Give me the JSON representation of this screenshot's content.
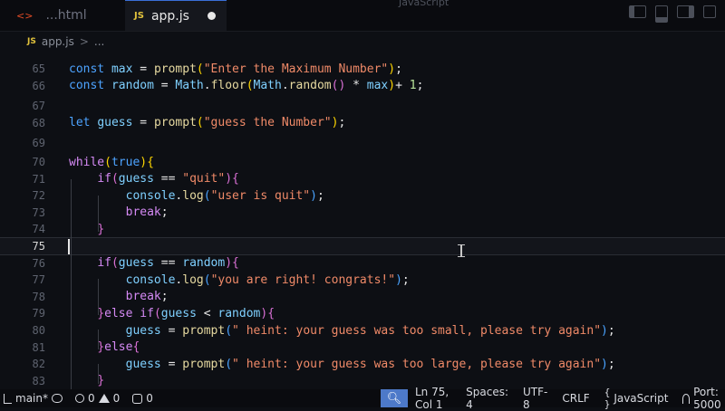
{
  "window_title": "JavaScript",
  "tabs": [
    {
      "label": "...html",
      "lead": "<>",
      "active": false
    },
    {
      "label": "app.js",
      "badge": "JS",
      "active": true,
      "modified": true
    }
  ],
  "breadcrumb": {
    "badge": "JS",
    "file": "app.js",
    "separator": ">",
    "more": "..."
  },
  "editor": {
    "current_line": 75,
    "lines": [
      {
        "num": "65",
        "tokens": [
          [
            "kw",
            "const "
          ],
          [
            "var",
            "max"
          ],
          [
            "op",
            " = "
          ],
          [
            "fn",
            "prompt"
          ],
          [
            "br1",
            "("
          ],
          [
            "str",
            "\"Enter the Maximum Number\""
          ],
          [
            "br1",
            ")"
          ],
          [
            "op",
            ";"
          ]
        ]
      },
      {
        "num": "66",
        "tokens": [
          [
            "kw",
            "const "
          ],
          [
            "var",
            "random"
          ],
          [
            "op",
            " = "
          ],
          [
            "obj",
            "Math"
          ],
          [
            "op",
            "."
          ],
          [
            "fn",
            "floor"
          ],
          [
            "br1",
            "("
          ],
          [
            "obj",
            "Math"
          ],
          [
            "op",
            "."
          ],
          [
            "fn",
            "random"
          ],
          [
            "br2",
            "()"
          ],
          [
            "op",
            " * "
          ],
          [
            "var",
            "max"
          ],
          [
            "br1",
            ")"
          ],
          [
            "op",
            "+ "
          ],
          [
            "num",
            "1"
          ],
          [
            "op",
            ";"
          ]
        ]
      },
      {
        "num": "67",
        "tokens": []
      },
      {
        "num": "68",
        "tokens": [
          [
            "kw",
            "let "
          ],
          [
            "var",
            "guess"
          ],
          [
            "op",
            " = "
          ],
          [
            "fn",
            "prompt"
          ],
          [
            "br1",
            "("
          ],
          [
            "str",
            "\"guess the Number\""
          ],
          [
            "br1",
            ")"
          ],
          [
            "op",
            ";"
          ]
        ]
      },
      {
        "num": "69",
        "tokens": []
      },
      {
        "num": "70",
        "tokens": [
          [
            "ctl",
            "while"
          ],
          [
            "br1",
            "("
          ],
          [
            "bool",
            "true"
          ],
          [
            "br1",
            ")"
          ],
          [
            "br1",
            "{"
          ]
        ]
      },
      {
        "num": "71",
        "tokens": [
          [
            "op",
            "    "
          ],
          [
            "ctl",
            "if"
          ],
          [
            "br2",
            "("
          ],
          [
            "var",
            "guess"
          ],
          [
            "op",
            " == "
          ],
          [
            "str",
            "\"quit\""
          ],
          [
            "br2",
            ")"
          ],
          [
            "br2",
            "{"
          ]
        ]
      },
      {
        "num": "72",
        "tokens": [
          [
            "op",
            "        "
          ],
          [
            "var",
            "console"
          ],
          [
            "op",
            "."
          ],
          [
            "fn",
            "log"
          ],
          [
            "br3",
            "("
          ],
          [
            "str",
            "\"user is quit\""
          ],
          [
            "br3",
            ")"
          ],
          [
            "op",
            ";"
          ]
        ]
      },
      {
        "num": "73",
        "tokens": [
          [
            "op",
            "        "
          ],
          [
            "ctl",
            "break"
          ],
          [
            "op",
            ";"
          ]
        ]
      },
      {
        "num": "74",
        "tokens": [
          [
            "op",
            "    "
          ],
          [
            "br2",
            "}"
          ]
        ]
      },
      {
        "num": "75",
        "tokens": []
      },
      {
        "num": "76",
        "tokens": [
          [
            "op",
            "    "
          ],
          [
            "ctl",
            "if"
          ],
          [
            "br2",
            "("
          ],
          [
            "var",
            "guess"
          ],
          [
            "op",
            " == "
          ],
          [
            "var",
            "random"
          ],
          [
            "br2",
            ")"
          ],
          [
            "br2",
            "{"
          ]
        ]
      },
      {
        "num": "77",
        "tokens": [
          [
            "op",
            "        "
          ],
          [
            "var",
            "console"
          ],
          [
            "op",
            "."
          ],
          [
            "fn",
            "log"
          ],
          [
            "br3",
            "("
          ],
          [
            "str",
            "\"you are right! congrats!\""
          ],
          [
            "br3",
            ")"
          ],
          [
            "op",
            ";"
          ]
        ]
      },
      {
        "num": "78",
        "tokens": [
          [
            "op",
            "        "
          ],
          [
            "ctl",
            "break"
          ],
          [
            "op",
            ";"
          ]
        ]
      },
      {
        "num": "79",
        "tokens": [
          [
            "op",
            "    "
          ],
          [
            "br2",
            "}"
          ],
          [
            "ctl",
            "else if"
          ],
          [
            "br2",
            "("
          ],
          [
            "var",
            "guess"
          ],
          [
            "op",
            " < "
          ],
          [
            "var",
            "random"
          ],
          [
            "br2",
            ")"
          ],
          [
            "br2",
            "{"
          ]
        ]
      },
      {
        "num": "80",
        "tokens": [
          [
            "op",
            "        "
          ],
          [
            "var",
            "guess"
          ],
          [
            "op",
            " = "
          ],
          [
            "fn",
            "prompt"
          ],
          [
            "br3",
            "("
          ],
          [
            "str",
            "\" heint: your guess was too small, please try again\""
          ],
          [
            "br3",
            ")"
          ],
          [
            "op",
            ";"
          ]
        ]
      },
      {
        "num": "81",
        "tokens": [
          [
            "op",
            "    "
          ],
          [
            "br2",
            "}"
          ],
          [
            "ctl",
            "else"
          ],
          [
            "br2",
            "{"
          ]
        ]
      },
      {
        "num": "82",
        "tokens": [
          [
            "op",
            "        "
          ],
          [
            "var",
            "guess"
          ],
          [
            "op",
            " = "
          ],
          [
            "fn",
            "prompt"
          ],
          [
            "br3",
            "("
          ],
          [
            "str",
            "\" heint: your guess was too large, please try again\""
          ],
          [
            "br3",
            ")"
          ],
          [
            "op",
            ";"
          ]
        ]
      },
      {
        "num": "83",
        "tokens": [
          [
            "op",
            "    "
          ],
          [
            "br2",
            "}"
          ]
        ]
      }
    ]
  },
  "statusbar": {
    "branch": "main*",
    "errors": "0",
    "warnings": "0",
    "debug_count": "0",
    "cursor": "Ln 75, Col 1",
    "spaces": "Spaces: 4",
    "encoding": "UTF-8",
    "eol": "CRLF",
    "language": "JavaScript",
    "port": "Port: 5000"
  },
  "colors": {
    "accent": "#4d79c9",
    "background": "#0d0f14"
  }
}
